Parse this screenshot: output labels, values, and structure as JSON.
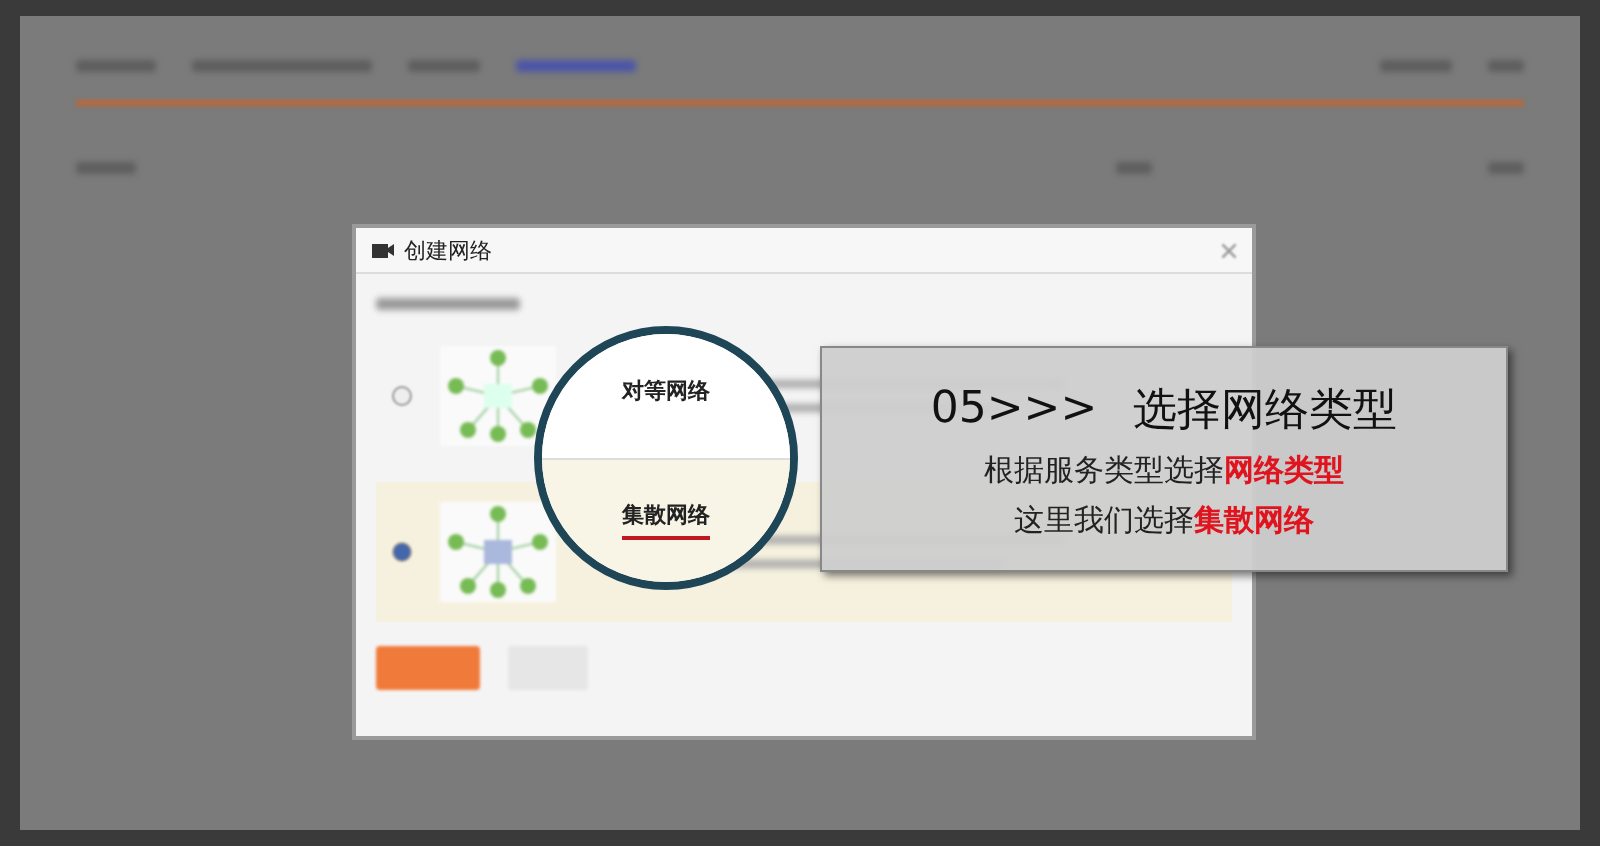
{
  "dialog": {
    "title": "创建网络",
    "options": [
      {
        "label": "对等网络",
        "selected": false
      },
      {
        "label": "集散网络",
        "selected": true
      }
    ]
  },
  "callout": {
    "step": "05>>>",
    "heading": "选择网络类型",
    "lines": [
      "根据服务类型选择**网络类型**",
      "这里我们选择**集散网络**"
    ]
  }
}
